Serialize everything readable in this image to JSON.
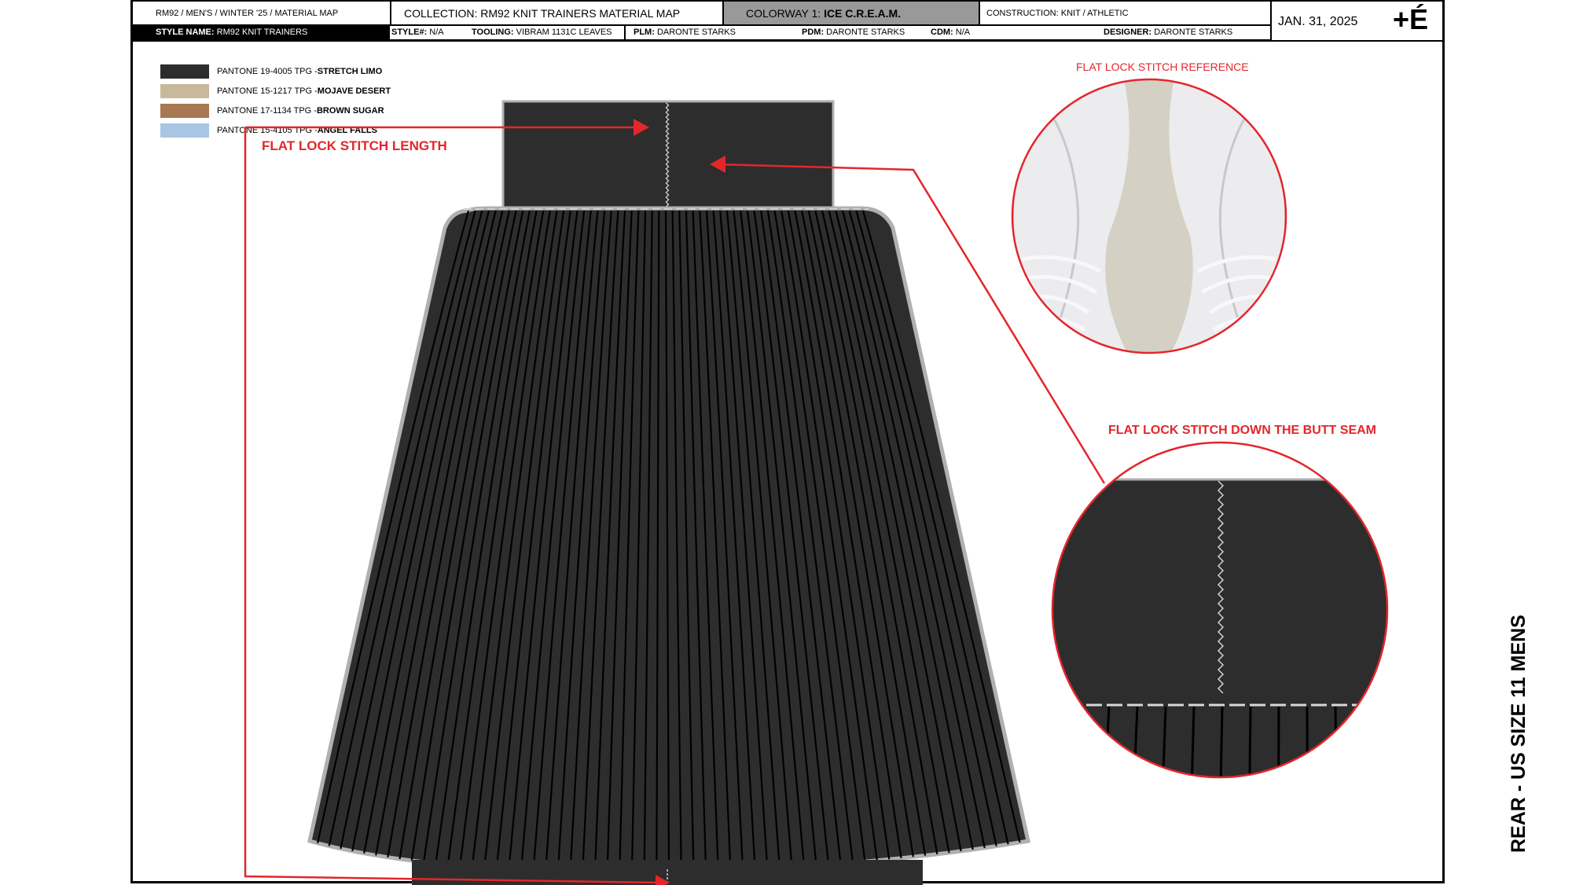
{
  "header": {
    "breadcrumb": "RM92 / MEN'S / WINTER '25 / MATERIAL MAP",
    "collection_label": "COLLECTION:",
    "collection_value": "RM92 KNIT TRAINERS MATERIAL MAP",
    "colorway_label": "COLORWAY 1:",
    "colorway_value": "ICE C.R.E.A.M.",
    "construction_label": "CONSTRUCTION:",
    "construction_value": "KNIT / ATHLETIC",
    "date": "JAN. 31, 2025",
    "logo": "+É",
    "style_name_label": "STYLE NAME:",
    "style_name_value": "RM92 KNIT TRAINERS",
    "style_no_label": "STYLE#:",
    "style_no_value": "N/A",
    "tooling_label": "TOOLING:",
    "tooling_value": "VIBRAM 1131C LEAVES",
    "plm_label": "PLM:",
    "plm_value": "DARONTE STARKS",
    "pdm_label": "PDM:",
    "pdm_value": "DARONTE STARKS",
    "cdm_label": "CDM:",
    "cdm_value": "N/A",
    "designer_label": "DESIGNER:",
    "designer_value": "DARONTE STARKS"
  },
  "legend": [
    {
      "code": "PANTONE 19-4005 TPG - ",
      "name": "STRETCH LIMO",
      "color": "#2d2d2d"
    },
    {
      "code": "PANTONE 15-1217 TPG - ",
      "name": "MOJAVE DESERT",
      "color": "#c9b99b"
    },
    {
      "code": "PANTONE 17-1134 TPG - ",
      "name": "BROWN SUGAR",
      "color": "#a87852"
    },
    {
      "code": "PANTONE 15-4105 TPG - ",
      "name": "ANGEL FALLS",
      "color": "#a8c5e3"
    }
  ],
  "annotations": {
    "stitch_length": "FLAT LOCK STITCH LENGTH",
    "stitch_reference": "FLAT LOCK STITCH REFERENCE",
    "butt_seam": "FLAT LOCK STITCH DOWN THE BUTT SEAM"
  },
  "view_label": "REAR - US SIZE 11 MENS",
  "colors": {
    "knit": "#2d2d2d",
    "outline": "#b0b0b0",
    "accent_red": "#e3262b",
    "colorway_cell": "#999999"
  }
}
